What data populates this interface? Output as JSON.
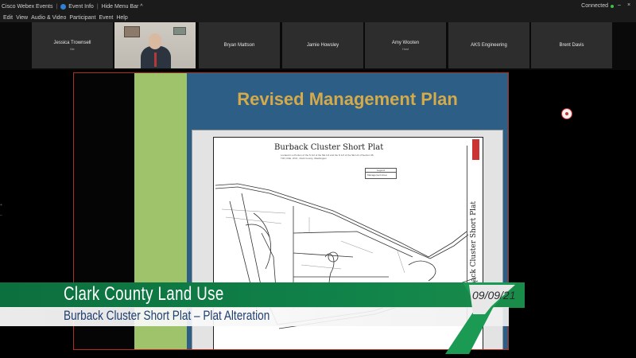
{
  "titlebar": {
    "app_name": "Cisco Webex Events",
    "event_info": "Event Info",
    "hide_menu": "Hide Menu Bar ^",
    "status": "Connected",
    "minimize": "–",
    "close": "×"
  },
  "menubar": {
    "items": [
      "Edit",
      "View",
      "Audio & Video",
      "Participant",
      "Event",
      "Help"
    ]
  },
  "participants": [
    {
      "name": "Jessica Trownsell",
      "sub": "Me"
    },
    {
      "name": "",
      "sub": ""
    },
    {
      "name": "Bryan Mattson",
      "sub": ""
    },
    {
      "name": "Jamie Howsley",
      "sub": ""
    },
    {
      "name": "Amy Wooten",
      "sub": "Host"
    },
    {
      "name": "AKS Engineering",
      "sub": ""
    },
    {
      "name": "Brent Davis",
      "sub": ""
    }
  ],
  "slide": {
    "title": "Revised Management Plan",
    "doc_title": "Burback Cluster Short Plat",
    "doc_subtitle": "Located in a Portion of the S 1/2 of the NE 1/4 and the N 1/2 of the SE 1/4 of Section 36, T3N, R1E, W.M., Clark County, Washington",
    "legend_title": "Legend",
    "legend_item": "Management Area",
    "side_label": "Burback Cluster Short Plat"
  },
  "lower_third": {
    "title": "Clark County Land Use",
    "subtitle": "Burback Cluster Short Plat – Plat Alteration",
    "date": "09/09/21"
  },
  "colors": {
    "slide_blue": "#2d5e86",
    "slide_title_gold": "#d4aa4a",
    "lower_third_green": "#11844a",
    "stage_border": "#b03020"
  }
}
